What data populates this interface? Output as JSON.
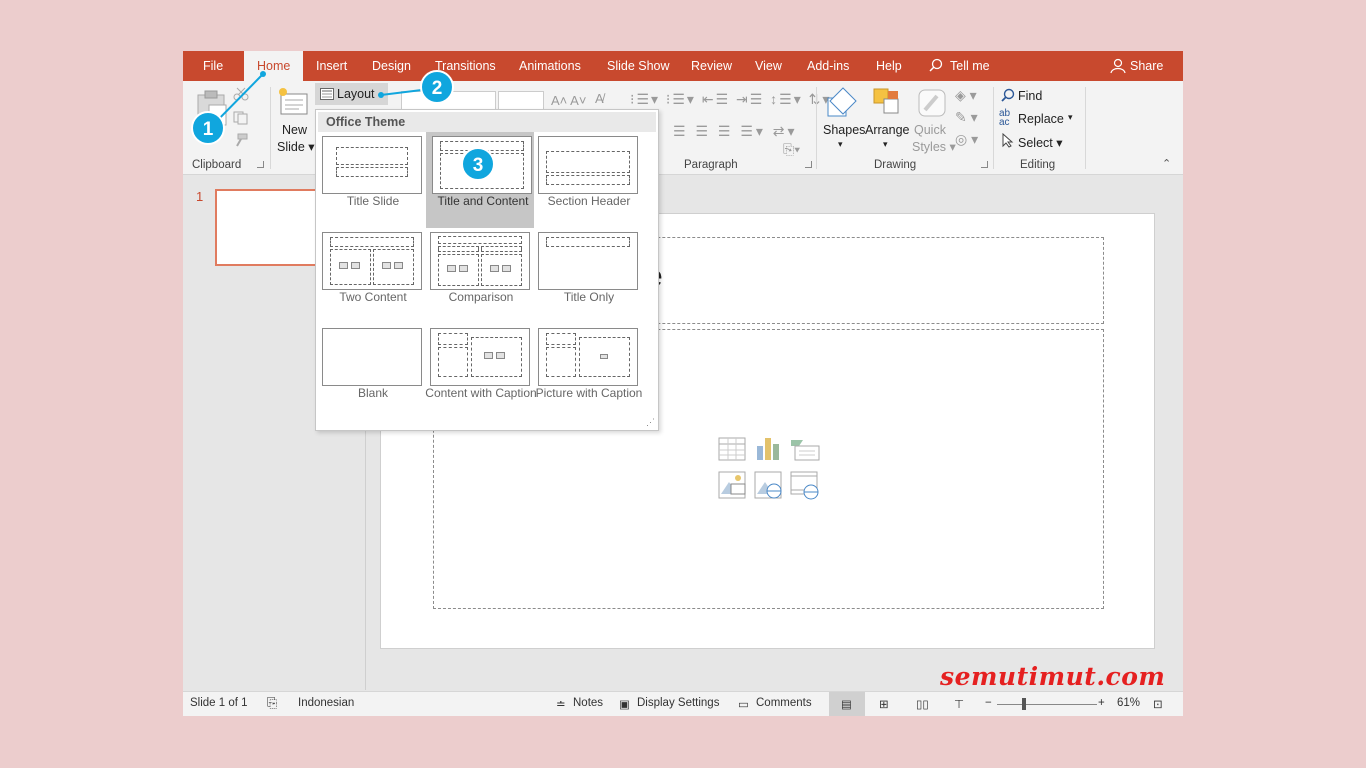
{
  "tabs": {
    "file": "File",
    "home": "Home",
    "insert": "Insert",
    "design": "Design",
    "transitions": "Transitions",
    "animations": "Animations",
    "slideshow": "Slide Show",
    "review": "Review",
    "view": "View",
    "addins": "Add-ins",
    "help": "Help",
    "tellme": "Tell me",
    "share": "Share"
  },
  "ribbon": {
    "clipboard_label": "Clipboard",
    "new_slide_line1": "New",
    "new_slide_line2": "Slide ▾",
    "layout_label": "Layout",
    "paragraph_label": "Paragraph",
    "shapes_label": "Shapes",
    "arrange_label": "Arrange",
    "quick_styles_line1": "Quick",
    "quick_styles_line2": "Styles ▾",
    "drawing_label": "Drawing",
    "find_label": "Find",
    "replace_label": "Replace",
    "select_label": "Select ▾",
    "editing_label": "Editing"
  },
  "dropdown": {
    "header": "Office Theme",
    "layouts": [
      {
        "name": "Title Slide"
      },
      {
        "name": "Title and Content"
      },
      {
        "name": "Section Header"
      },
      {
        "name": "Two Content"
      },
      {
        "name": "Comparison"
      },
      {
        "name": "Title Only"
      },
      {
        "name": "Blank"
      },
      {
        "name": "Content with Caption"
      },
      {
        "name": "Picture with Caption"
      }
    ],
    "selected": "Title and Content"
  },
  "thumbnails": {
    "slide_number": "1"
  },
  "slide": {
    "title_fragment": "e"
  },
  "status": {
    "slide_of": "Slide 1 of 1",
    "language": "Indonesian",
    "notes": "Notes",
    "display_settings": "Display Settings",
    "comments": "Comments",
    "zoom_level": "61%"
  },
  "callouts": {
    "c1": "1",
    "c2": "2",
    "c3": "3"
  },
  "watermark": "semutimut.com",
  "colors": {
    "accent": "#c8492e",
    "callout": "#10a6de",
    "background": "#eccdcd",
    "watermark": "#e52020"
  }
}
